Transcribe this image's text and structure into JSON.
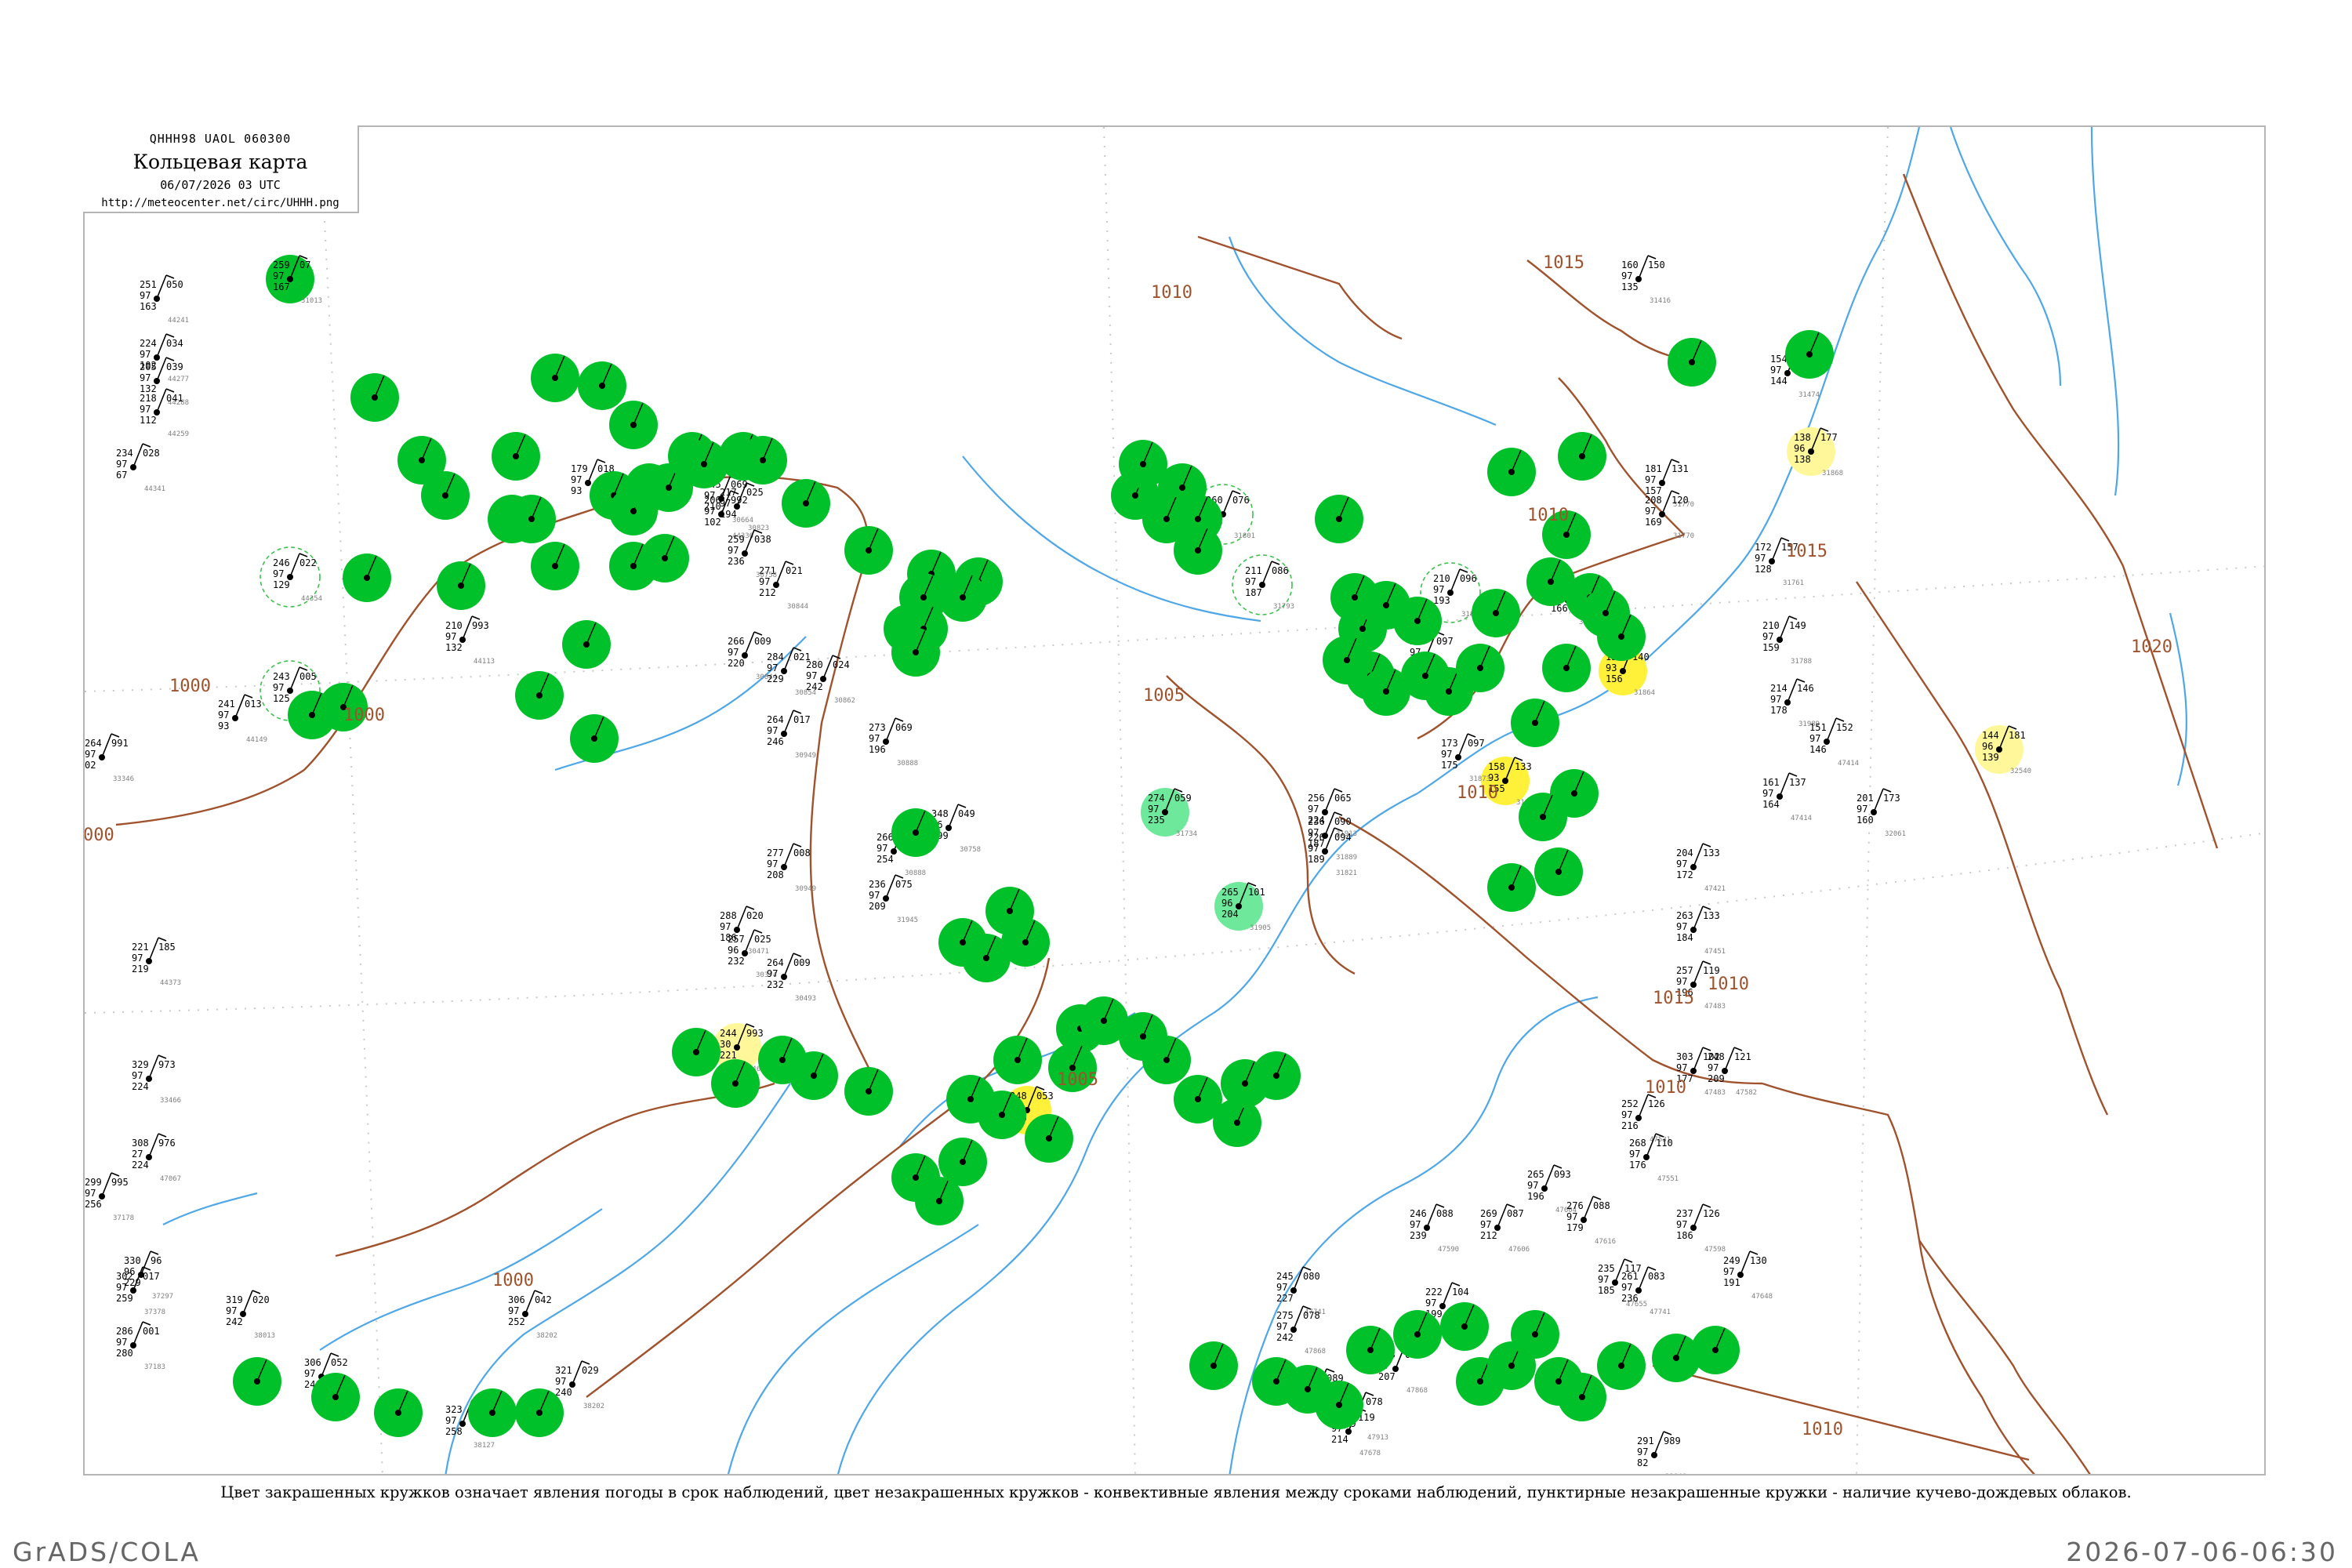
{
  "header": {
    "bulletin_code": "QHHH98  UAOL  060300",
    "title": "Кольцевая карта",
    "datetime": "06/07/2026 03 UTC",
    "url": "http://meteocenter.net/circ/UHHH.png"
  },
  "caption": "Цвет закрашенных кружков означает явления погоды в срок наблюдений, цвет незакрашенных кружков - конвективные явления между сроками наблюдений, пунктирные незакрашенные кружки - наличие кучево-дождевых облаков.",
  "footer": {
    "software": "GrADS/COLA",
    "timestamp": "2026-07-06-06:30"
  },
  "colors": {
    "precip_fill": "#00c12a",
    "shower_fill": "#6ee89a",
    "fog_fill": "#fff13a",
    "haze_fill": "#fff799",
    "cb_ring": "#3fc04f",
    "isobar": "#a0522d",
    "water": "#4fa7e8",
    "label_gray": "#808080"
  },
  "isobar_labels": [
    "1000",
    "1005",
    "1010",
    "1015",
    "1020"
  ],
  "stations": [
    {
      "pressure": "259",
      "code": "07",
      "temp": "97",
      "dew": "167",
      "index": "31013",
      "weather": "precip"
    },
    {
      "pressure": "251",
      "code": "050",
      "temp": "97",
      "dew": "163",
      "index": "44241",
      "weather": "none"
    },
    {
      "pressure": "224",
      "code": "034",
      "temp": "97",
      "dew": "102",
      "index": "44277",
      "weather": "none"
    },
    {
      "pressure": "205",
      "code": "039",
      "temp": "97",
      "dew": "132",
      "index": "44288",
      "weather": "none"
    },
    {
      "pressure": "218",
      "code": "041",
      "temp": "97",
      "dew": "112",
      "index": "44259",
      "weather": "none"
    },
    {
      "pressure": "234",
      "code": "028",
      "temp": "97",
      "dew": "67",
      "index": "44341",
      "weather": "none"
    },
    {
      "pressure": "246",
      "code": "022",
      "temp": "97",
      "dew": "129",
      "index": "44354",
      "weather": "cb"
    },
    {
      "pressure": "243",
      "code": "005",
      "temp": "97",
      "dew": "125",
      "index": "30949",
      "weather": "cb"
    },
    {
      "pressure": "241",
      "code": "013",
      "temp": "97",
      "dew": "93",
      "index": "44149",
      "weather": "none"
    },
    {
      "pressure": "264",
      "code": "991",
      "temp": "97",
      "dew": "02",
      "index": "33346",
      "weather": "none"
    },
    {
      "pressure": "179",
      "code": "018",
      "temp": "97",
      "dew": "93",
      "index": "44314",
      "weather": "none"
    },
    {
      "pressure": "210",
      "code": "993",
      "temp": "97",
      "dew": "132",
      "index": "44113",
      "weather": "none"
    },
    {
      "pressure": "206",
      "code": "992",
      "temp": "97",
      "dew": "102",
      "index": "44336",
      "weather": "none"
    },
    {
      "pressure": "217",
      "code": "025",
      "temp": "97",
      "dew": "194",
      "index": "30823",
      "weather": "none"
    },
    {
      "pressure": "271",
      "code": "021",
      "temp": "97",
      "dew": "212",
      "index": "30844",
      "weather": "none"
    },
    {
      "pressure": "266",
      "code": "009",
      "temp": "97",
      "dew": "220",
      "index": "30844",
      "weather": "none"
    },
    {
      "pressure": "284",
      "code": "021",
      "temp": "97",
      "dew": "229",
      "index": "30854",
      "weather": "none"
    },
    {
      "pressure": "280",
      "code": "024",
      "temp": "97",
      "dew": "242",
      "index": "30862",
      "weather": "none"
    },
    {
      "pressure": "259",
      "code": "038",
      "temp": "97",
      "dew": "236",
      "index": "30758",
      "weather": "none"
    },
    {
      "pressure": "264",
      "code": "017",
      "temp": "97",
      "dew": "246",
      "index": "30949",
      "weather": "none"
    },
    {
      "pressure": "245",
      "code": "069",
      "temp": "97",
      "dew": "210",
      "index": "30664",
      "weather": "none"
    },
    {
      "pressure": "273",
      "code": "069",
      "temp": "97",
      "dew": "196",
      "index": "30888",
      "weather": "none"
    },
    {
      "pressure": "266",
      "code": "075",
      "temp": "97",
      "dew": "254",
      "index": "30888",
      "weather": "none"
    },
    {
      "pressure": "348",
      "code": "049",
      "temp": "96",
      "dew": "199",
      "index": "30758",
      "weather": "none"
    },
    {
      "pressure": "236",
      "code": "075",
      "temp": "97",
      "dew": "209",
      "index": "31945",
      "weather": "none"
    },
    {
      "pressure": "277",
      "code": "008",
      "temp": "97",
      "dew": "208",
      "index": "30949",
      "weather": "none"
    },
    {
      "pressure": "288",
      "code": "020",
      "temp": "97",
      "dew": "186",
      "index": "30471",
      "weather": "none"
    },
    {
      "pressure": "257",
      "code": "025",
      "temp": "96",
      "dew": "232",
      "index": "30374",
      "weather": "none"
    },
    {
      "pressure": "264",
      "code": "009",
      "temp": "97",
      "dew": "232",
      "index": "30493",
      "weather": "none"
    },
    {
      "pressure": "244",
      "code": "993",
      "temp": "30",
      "dew": "221",
      "index": "44662",
      "weather": "haze"
    },
    {
      "pressure": "248",
      "code": "053",
      "temp": "93",
      "dew": "236",
      "index": "47065",
      "weather": "fog"
    },
    {
      "pressure": "158",
      "code": "133",
      "temp": "93",
      "dew": "155",
      "index": "31873",
      "weather": "fog"
    },
    {
      "pressure": "156",
      "code": "140",
      "temp": "93",
      "dew": "156",
      "index": "31864",
      "weather": "fog"
    },
    {
      "pressure": "138",
      "code": "177",
      "temp": "96",
      "dew": "138",
      "index": "31868",
      "weather": "haze"
    },
    {
      "pressure": "144",
      "code": "181",
      "temp": "96",
      "dew": "139",
      "index": "32540",
      "weather": "haze"
    },
    {
      "pressure": "274",
      "code": "059",
      "temp": "97",
      "dew": "235",
      "index": "31734",
      "weather": "shower"
    },
    {
      "pressure": "265",
      "code": "101",
      "temp": "96",
      "dew": "204",
      "index": "31905",
      "weather": "shower"
    },
    {
      "pressure": "256",
      "code": "065",
      "temp": "97",
      "dew": "224",
      "index": "31913",
      "weather": "none"
    },
    {
      "pressure": "236",
      "code": "090",
      "temp": "97",
      "dew": "187",
      "index": "31889",
      "weather": "none"
    },
    {
      "pressure": "226",
      "code": "094",
      "temp": "97",
      "dew": "189",
      "index": "31821",
      "weather": "none"
    },
    {
      "pressure": "260",
      "code": "076",
      "temp": "97",
      "dew": "205",
      "index": "31801",
      "weather": "cb"
    },
    {
      "pressure": "211",
      "code": "086",
      "temp": "97",
      "dew": "187",
      "index": "31793",
      "weather": "cb"
    },
    {
      "pressure": "229",
      "code": "097",
      "temp": "97",
      "dew": "191",
      "index": "31884",
      "weather": "none"
    },
    {
      "pressure": "210",
      "code": "096",
      "temp": "97",
      "dew": "193",
      "index": "31863",
      "weather": "cb"
    },
    {
      "pressure": "173",
      "code": "097",
      "temp": "97",
      "dew": "175",
      "index": "31873",
      "weather": "none"
    },
    {
      "pressure": "210",
      "code": "126",
      "temp": "97",
      "dew": "166",
      "index": "31706",
      "weather": "none"
    },
    {
      "pressure": "181",
      "code": "131",
      "temp": "97",
      "dew": "157",
      "index": "31770",
      "weather": "none"
    },
    {
      "pressure": "208",
      "code": "120",
      "temp": "97",
      "dew": "169",
      "index": "31770",
      "weather": "none"
    },
    {
      "pressure": "172",
      "code": "157",
      "temp": "97",
      "dew": "128",
      "index": "31761",
      "weather": "none"
    },
    {
      "pressure": "210",
      "code": "149",
      "temp": "97",
      "dew": "159",
      "index": "31788",
      "weather": "none"
    },
    {
      "pressure": "160",
      "code": "150",
      "temp": "97",
      "dew": "135",
      "index": "31416",
      "weather": "none"
    },
    {
      "pressure": "154",
      "code": "152",
      "temp": "97",
      "dew": "144",
      "index": "31474",
      "weather": "none"
    },
    {
      "pressure": "214",
      "code": "146",
      "temp": "97",
      "dew": "178",
      "index": "31989",
      "weather": "none"
    },
    {
      "pressure": "161",
      "code": "137",
      "temp": "97",
      "dew": "164",
      "index": "47414",
      "weather": "none"
    },
    {
      "pressure": "151",
      "code": "152",
      "temp": "97",
      "dew": "146",
      "index": "47414",
      "weather": "none"
    },
    {
      "pressure": "201",
      "code": "173",
      "temp": "97",
      "dew": "160",
      "index": "32061",
      "weather": "none"
    },
    {
      "pressure": "204",
      "code": "133",
      "temp": "97",
      "dew": "172",
      "index": "47421",
      "weather": "none"
    },
    {
      "pressure": "263",
      "code": "133",
      "temp": "97",
      "dew": "184",
      "index": "47451",
      "weather": "none"
    },
    {
      "pressure": "257",
      "code": "119",
      "temp": "97",
      "dew": "196",
      "index": "47483",
      "weather": "none"
    },
    {
      "pressure": "303",
      "code": "102",
      "temp": "97",
      "dew": "177",
      "index": "47483",
      "weather": "none"
    },
    {
      "pressure": "252",
      "code": "126",
      "temp": "97",
      "dew": "216",
      "index": "47531",
      "weather": "none"
    },
    {
      "pressure": "268",
      "code": "110",
      "temp": "97",
      "dew": "176",
      "index": "47551",
      "weather": "none"
    },
    {
      "pressure": "248",
      "code": "121",
      "temp": "97",
      "dew": "209",
      "index": "47582",
      "weather": "none"
    },
    {
      "pressure": "237",
      "code": "126",
      "temp": "97",
      "dew": "186",
      "index": "47598",
      "weather": "none"
    },
    {
      "pressure": "249",
      "code": "130",
      "temp": "97",
      "dew": "191",
      "index": "47648",
      "weather": "none"
    },
    {
      "pressure": "265",
      "code": "093",
      "temp": "97",
      "dew": "196",
      "index": "47604",
      "weather": "none"
    },
    {
      "pressure": "276",
      "code": "088",
      "temp": "97",
      "dew": "179",
      "index": "47616",
      "weather": "none"
    },
    {
      "pressure": "269",
      "code": "087",
      "temp": "97",
      "dew": "212",
      "index": "47606",
      "weather": "none"
    },
    {
      "pressure": "246",
      "code": "088",
      "temp": "97",
      "dew": "239",
      "index": "47590",
      "weather": "none"
    },
    {
      "pressure": "222",
      "code": "104",
      "temp": "97",
      "dew": "199",
      "index": "47670",
      "weather": "none"
    },
    {
      "pressure": "235",
      "code": "117",
      "temp": "97",
      "dew": "185",
      "index": "47655",
      "weather": "none"
    },
    {
      "pressure": "261",
      "code": "083",
      "temp": "97",
      "dew": "236",
      "index": "47741",
      "weather": "none"
    },
    {
      "pressure": "245",
      "code": "080",
      "temp": "97",
      "dew": "227",
      "index": "47741",
      "weather": "none"
    },
    {
      "pressure": "275",
      "code": "078",
      "temp": "97",
      "dew": "242",
      "index": "47868",
      "weather": "none"
    },
    {
      "pressure": "258",
      "code": "086",
      "temp": "97",
      "dew": "207",
      "index": "47868",
      "weather": "none"
    },
    {
      "pressure": "266",
      "code": "078",
      "temp": "97",
      "dew": "239",
      "index": "47913",
      "weather": "none"
    },
    {
      "pressure": "237",
      "code": "089",
      "temp": "97",
      "dew": "230",
      "index": "47778",
      "weather": "none"
    },
    {
      "pressure": "221",
      "code": "119",
      "temp": "97",
      "dew": "214",
      "index": "47678",
      "weather": "none"
    },
    {
      "pressure": "291",
      "code": "989",
      "temp": "97",
      "dew": "82",
      "index": "33846",
      "weather": "none"
    },
    {
      "pressure": "221",
      "code": "185",
      "temp": "97",
      "dew": "219",
      "index": "44373",
      "weather": "none"
    },
    {
      "pressure": "329",
      "code": "973",
      "temp": "97",
      "dew": "224",
      "index": "33466",
      "weather": "none"
    },
    {
      "pressure": "308",
      "code": "976",
      "temp": "27",
      "dew": "224",
      "index": "47067",
      "weather": "none"
    },
    {
      "pressure": "299",
      "code": "995",
      "temp": "97",
      "dew": "256",
      "index": "37178",
      "weather": "none"
    },
    {
      "pressure": "302",
      "code": "017",
      "temp": "97",
      "dew": "259",
      "index": "37378",
      "weather": "none"
    },
    {
      "pressure": "286",
      "code": "001",
      "temp": "97",
      "dew": "280",
      "index": "37183",
      "weather": "none"
    },
    {
      "pressure": "330",
      "code": "96",
      "temp": "96",
      "dew": "229",
      "index": "37297",
      "weather": "none"
    },
    {
      "pressure": "319",
      "code": "020",
      "temp": "97",
      "dew": "242",
      "index": "38013",
      "weather": "none"
    },
    {
      "pressure": "306",
      "code": "052",
      "temp": "97",
      "dew": "240",
      "index": "38288",
      "weather": "none"
    },
    {
      "pressure": "323",
      "code": "014",
      "temp": "97",
      "dew": "258",
      "index": "38127",
      "weather": "none"
    },
    {
      "pressure": "306",
      "code": "042",
      "temp": "97",
      "dew": "252",
      "index": "38202",
      "weather": "none"
    },
    {
      "pressure": "321",
      "code": "029",
      "temp": "97",
      "dew": "240",
      "index": "38202",
      "weather": "none"
    }
  ]
}
